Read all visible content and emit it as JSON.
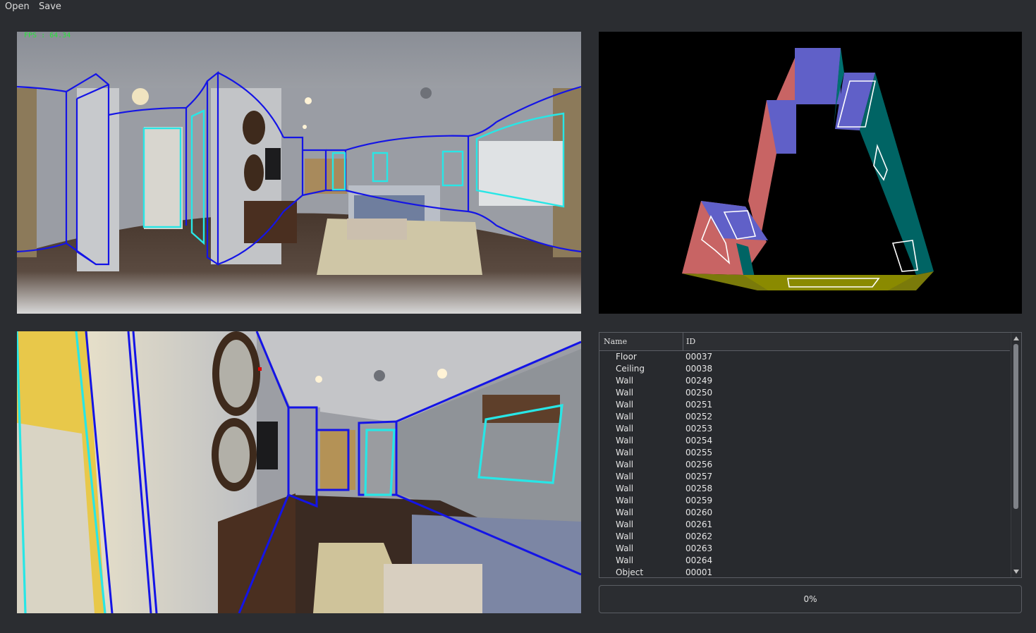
{
  "menu": {
    "open": "Open",
    "save": "Save"
  },
  "panorama": {
    "fps_text": "FPS : 64.34"
  },
  "table": {
    "headers": {
      "name": "Name",
      "id": "ID"
    },
    "rows": [
      {
        "name": "Floor",
        "id": "00037"
      },
      {
        "name": "Ceiling",
        "id": "00038"
      },
      {
        "name": "Wall",
        "id": "00249"
      },
      {
        "name": "Wall",
        "id": "00250"
      },
      {
        "name": "Wall",
        "id": "00251"
      },
      {
        "name": "Wall",
        "id": "00252"
      },
      {
        "name": "Wall",
        "id": "00253"
      },
      {
        "name": "Wall",
        "id": "00254"
      },
      {
        "name": "Wall",
        "id": "00255"
      },
      {
        "name": "Wall",
        "id": "00256"
      },
      {
        "name": "Wall",
        "id": "00257"
      },
      {
        "name": "Wall",
        "id": "00258"
      },
      {
        "name": "Wall",
        "id": "00259"
      },
      {
        "name": "Wall",
        "id": "00260"
      },
      {
        "name": "Wall",
        "id": "00261"
      },
      {
        "name": "Wall",
        "id": "00262"
      },
      {
        "name": "Wall",
        "id": "00263"
      },
      {
        "name": "Wall",
        "id": "00264"
      },
      {
        "name": "Object",
        "id": "00001"
      }
    ]
  },
  "progress": {
    "value": 0,
    "label": "0%"
  },
  "colors": {
    "layout_line": "#1414e6",
    "opening_line": "#28e6e6",
    "fps_text": "#27e23b",
    "ceiling_face": "#6060c8",
    "wall_red": "#c86464",
    "wall_teal": "#006464",
    "floor_olive": "#7a7a0a"
  }
}
